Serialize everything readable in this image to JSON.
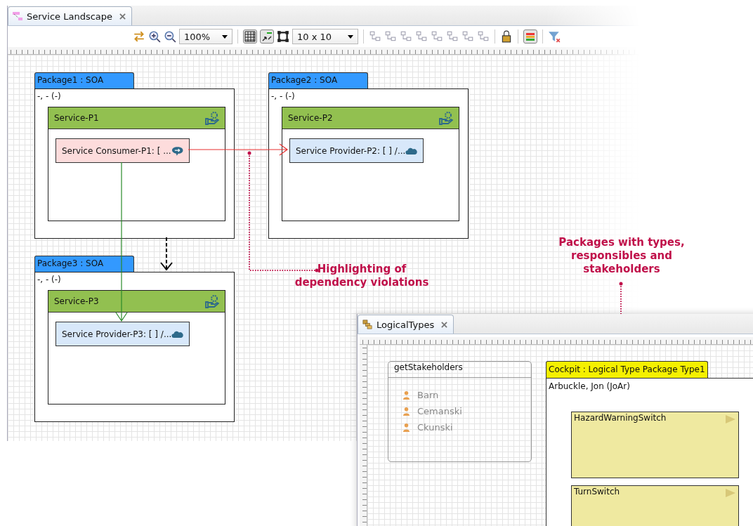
{
  "editor": {
    "tab": {
      "label": "Service Landscape"
    },
    "toolbar": {
      "zoom": "100%",
      "grid_size": "10 x 10"
    },
    "packages": [
      {
        "title": "Package1 : SOA",
        "info": "-, - (-)",
        "service": {
          "title": "Service-P1",
          "component": {
            "kind": "consumer",
            "label": "Service Consumer-P1: [ ..."
          }
        }
      },
      {
        "title": "Package2 : SOA",
        "info": "-, - (-)",
        "service": {
          "title": "Service-P2",
          "component": {
            "kind": "provider",
            "label": "Service Provider-P2: [ ] /..."
          }
        }
      },
      {
        "title": "Package3 : SOA",
        "info": "-, - (-)",
        "service": {
          "title": "Service-P3",
          "component": {
            "kind": "provider",
            "label": "Service Provider-P3: [ ] /..."
          }
        }
      }
    ]
  },
  "callouts": [
    {
      "text": "Highlighting of dependency violations"
    },
    {
      "text": "Packages with types, responsibles and stakeholders"
    }
  ],
  "logical_types": {
    "tab": {
      "label": "LogicalTypes"
    },
    "stakeholders": {
      "title": "getStakeholders",
      "names": [
        "Barn",
        "Cemanski",
        "Ckunski"
      ]
    },
    "package": {
      "title": "Cockpit : Logical Type Package Type1",
      "responsible": "Arbuckle, Jon (JoAr)",
      "types": [
        "HazardWarningSwitch",
        "TurnSwitch"
      ]
    }
  }
}
